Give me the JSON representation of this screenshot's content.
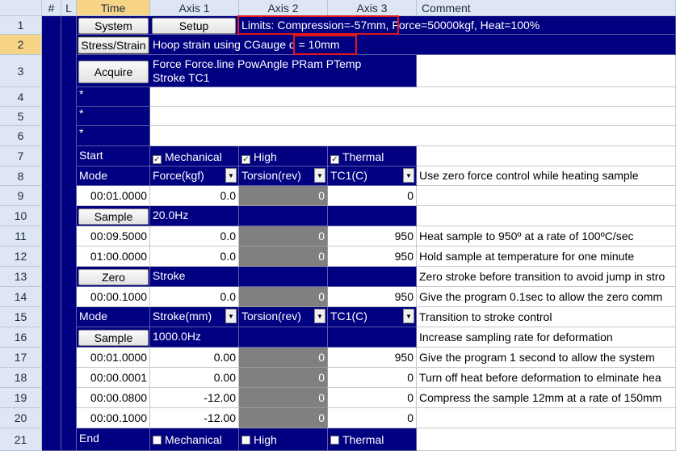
{
  "header": {
    "rownum": "",
    "hash": "#",
    "l": "L",
    "time": "Time",
    "axis1": "Axis 1",
    "axis2": "Axis 2",
    "axis3": "Axis 3",
    "comment": "Comment"
  },
  "row_numbers": [
    "1",
    "2",
    "3",
    "4",
    "5",
    "6",
    "7",
    "8",
    "9",
    "10",
    "11",
    "12",
    "13",
    "14",
    "15",
    "16",
    "17",
    "18",
    "19",
    "20",
    "21"
  ],
  "r1": {
    "button": "System",
    "button2": "Setup",
    "limits": "Limits: Compression=-57mm,",
    "rest": " Force=50000kgf, Heat=100%"
  },
  "r2": {
    "button": "Stress/Strain",
    "text": "Hoop strain using CGauge",
    "d": "d = 10mm"
  },
  "r3": {
    "button": "Acquire",
    "line1": "Force Force.line PowAngle PRam PTemp",
    "line2": "Stroke TC1"
  },
  "r4": {
    "star": "*"
  },
  "r5": {
    "star": "*"
  },
  "r6": {
    "star": "*"
  },
  "r7": {
    "label": "Start",
    "a1": "Mechanical",
    "a2": "High",
    "a3": "Thermal"
  },
  "r8": {
    "label": "Mode",
    "a1": "Force(kgf)",
    "a2": "Torsion(rev)",
    "a3": "TC1(C)",
    "comment": "Use zero force control while heating sample"
  },
  "r9": {
    "time": "00:01.0000",
    "a1": "0.0",
    "a2": "0",
    "a3": "0"
  },
  "r10": {
    "button": "Sample",
    "a1": "20.0Hz"
  },
  "r11": {
    "time": "00:09.5000",
    "a1": "0.0",
    "a2": "0",
    "a3": "950",
    "comment": "Heat sample to 950º at a rate of 100ºC/sec"
  },
  "r12": {
    "time": "01:00.0000",
    "a1": "0.0",
    "a2": "0",
    "a3": "950",
    "comment": "Hold sample at temperature for one minute"
  },
  "r13": {
    "button": "Zero",
    "a1": "Stroke",
    "comment": "Zero stroke before transition to avoid jump in stro"
  },
  "r14": {
    "time": "00:00.1000",
    "a1": "0.0",
    "a2": "0",
    "a3": "950",
    "comment": "Give the program 0.1sec to allow the zero comm"
  },
  "r15": {
    "label": "Mode",
    "a1": "Stroke(mm)",
    "a2": "Torsion(rev)",
    "a3": "TC1(C)",
    "comment": "Transition to stroke control"
  },
  "r16": {
    "button": "Sample",
    "a1": "1000.0Hz",
    "comment": "Increase sampling rate for deformation"
  },
  "r17": {
    "time": "00:01.0000",
    "a1": "0.00",
    "a2": "0",
    "a3": "950",
    "comment": "Give the program 1 second to allow the system"
  },
  "r18": {
    "time": "00:00.0001",
    "a1": "0.00",
    "a2": "0",
    "a3": "0",
    "comment": "Turn off heat before deformation to elminate hea"
  },
  "r19": {
    "time": "00:00.0800",
    "a1": "-12.00",
    "a2": "0",
    "a3": "0",
    "comment": "Compress the sample 12mm at a rate of 150mm"
  },
  "r20": {
    "time": "00:00.1000",
    "a1": "-12.00",
    "a2": "0",
    "a3": "0"
  },
  "r21": {
    "label": "End",
    "a1": "Mechanical",
    "a2": "High",
    "a3": "Thermal"
  },
  "check_mark": "✓",
  "colors": {
    "navy": "#000080",
    "gray": "#808080",
    "header": "#dde6f2",
    "selected_header": "#f8d586",
    "highlight": "#e0191c"
  }
}
